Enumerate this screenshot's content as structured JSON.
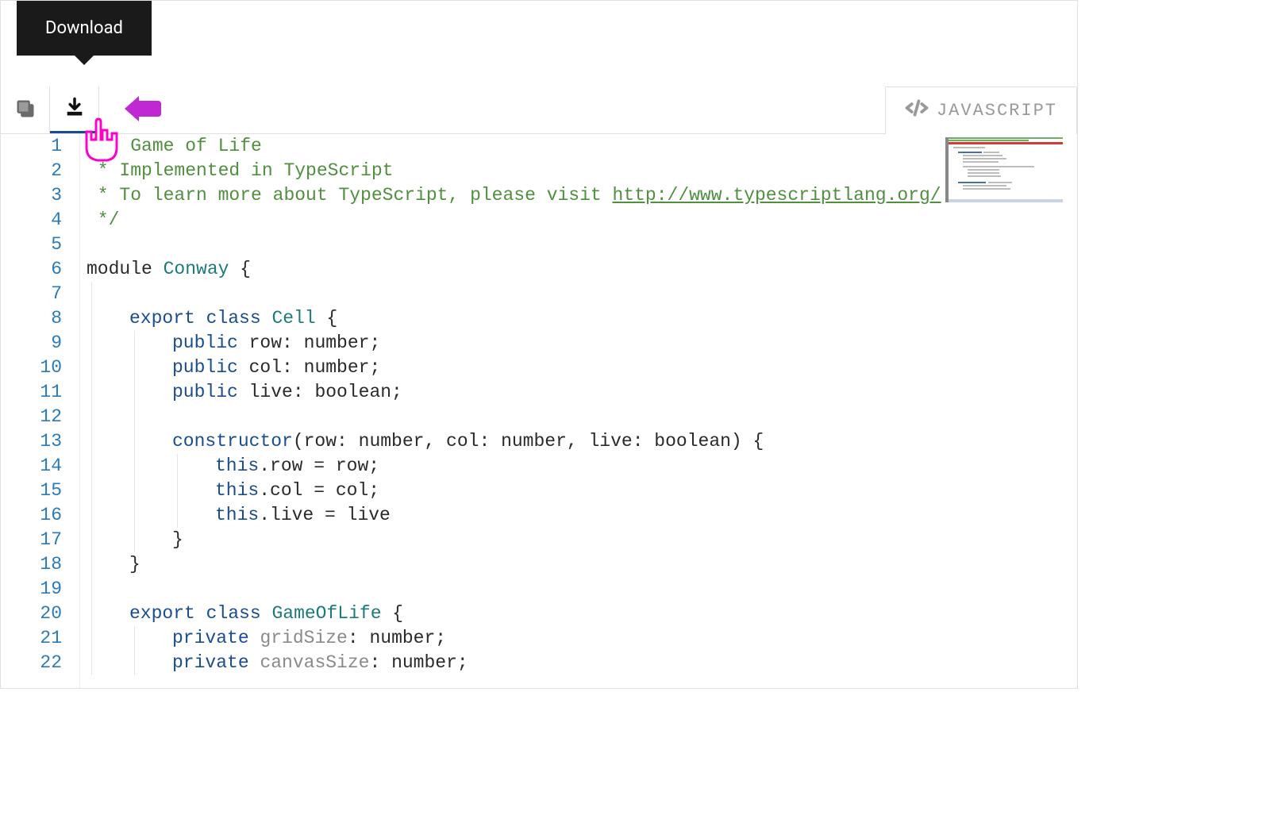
{
  "tooltip": {
    "text": "Download"
  },
  "tab": {
    "label": "JAVASCRIPT"
  },
  "colors": {
    "comment": "#4f8f3e",
    "keyword": "#1a4d8f",
    "type": "#1d7a7a",
    "plain": "#2a2a2a",
    "member": "#8a8a8a",
    "lineNumber": "#2b7bb9",
    "tooltipBg": "#1a1a1a",
    "annotationArrow": "#c028d4"
  },
  "lineNumbers": [
    "1",
    "2",
    "3",
    "4",
    "5",
    "6",
    "7",
    "8",
    "9",
    "10",
    "11",
    "12",
    "13",
    "14",
    "15",
    "16",
    "17",
    "18",
    "19",
    "20",
    "21",
    "22"
  ],
  "code": {
    "lines": [
      {
        "indent": 0,
        "tokens": [
          {
            "cls": "c-comment",
            "t": "/** Game of Life"
          }
        ]
      },
      {
        "indent": 0,
        "tokens": [
          {
            "cls": "c-comment",
            "t": " * Implemented in TypeScript"
          }
        ]
      },
      {
        "indent": 0,
        "tokens": [
          {
            "cls": "c-comment",
            "t": " * To learn more about TypeScript, please visit "
          },
          {
            "cls": "c-link",
            "t": "http://www.typescriptlang.org/"
          }
        ]
      },
      {
        "indent": 0,
        "tokens": [
          {
            "cls": "c-comment",
            "t": " */"
          }
        ]
      },
      {
        "indent": 0,
        "tokens": []
      },
      {
        "indent": 0,
        "tokens": [
          {
            "cls": "c-plain",
            "t": "module "
          },
          {
            "cls": "c-type",
            "t": "Conway"
          },
          {
            "cls": "c-plain",
            "t": " {"
          }
        ]
      },
      {
        "indent": 1,
        "tokens": []
      },
      {
        "indent": 1,
        "tokens": [
          {
            "cls": "c-keyword",
            "t": "export"
          },
          {
            "cls": "c-plain",
            "t": " "
          },
          {
            "cls": "c-keyword",
            "t": "class"
          },
          {
            "cls": "c-plain",
            "t": " "
          },
          {
            "cls": "c-type",
            "t": "Cell"
          },
          {
            "cls": "c-plain",
            "t": " {"
          }
        ]
      },
      {
        "indent": 2,
        "tokens": [
          {
            "cls": "c-keyword",
            "t": "public"
          },
          {
            "cls": "c-plain",
            "t": " row: number;"
          }
        ]
      },
      {
        "indent": 2,
        "tokens": [
          {
            "cls": "c-keyword",
            "t": "public"
          },
          {
            "cls": "c-plain",
            "t": " col: number;"
          }
        ]
      },
      {
        "indent": 2,
        "tokens": [
          {
            "cls": "c-keyword",
            "t": "public"
          },
          {
            "cls": "c-plain",
            "t": " live: boolean;"
          }
        ]
      },
      {
        "indent": 2,
        "tokens": []
      },
      {
        "indent": 2,
        "tokens": [
          {
            "cls": "c-keyword",
            "t": "constructor"
          },
          {
            "cls": "c-plain",
            "t": "(row: number, col: number, live: boolean) {"
          }
        ]
      },
      {
        "indent": 3,
        "tokens": [
          {
            "cls": "c-keyword",
            "t": "this"
          },
          {
            "cls": "c-plain",
            "t": ".row = row;"
          }
        ]
      },
      {
        "indent": 3,
        "tokens": [
          {
            "cls": "c-keyword",
            "t": "this"
          },
          {
            "cls": "c-plain",
            "t": ".col = col;"
          }
        ]
      },
      {
        "indent": 3,
        "tokens": [
          {
            "cls": "c-keyword",
            "t": "this"
          },
          {
            "cls": "c-plain",
            "t": ".live = live"
          }
        ]
      },
      {
        "indent": 2,
        "tokens": [
          {
            "cls": "c-plain",
            "t": "}"
          }
        ]
      },
      {
        "indent": 1,
        "tokens": [
          {
            "cls": "c-plain",
            "t": "}"
          }
        ]
      },
      {
        "indent": 1,
        "tokens": []
      },
      {
        "indent": 1,
        "tokens": [
          {
            "cls": "c-keyword",
            "t": "export"
          },
          {
            "cls": "c-plain",
            "t": " "
          },
          {
            "cls": "c-keyword",
            "t": "class"
          },
          {
            "cls": "c-plain",
            "t": " "
          },
          {
            "cls": "c-type",
            "t": "GameOfLife"
          },
          {
            "cls": "c-plain",
            "t": " {"
          }
        ]
      },
      {
        "indent": 2,
        "tokens": [
          {
            "cls": "c-keyword",
            "t": "private"
          },
          {
            "cls": "c-plain",
            "t": " "
          },
          {
            "cls": "c-member",
            "t": "gridSize"
          },
          {
            "cls": "c-plain",
            "t": ": number;"
          }
        ]
      },
      {
        "indent": 2,
        "tokens": [
          {
            "cls": "c-keyword",
            "t": "private"
          },
          {
            "cls": "c-plain",
            "t": " "
          },
          {
            "cls": "c-member",
            "t": "canvasSize"
          },
          {
            "cls": "c-plain",
            "t": ": number;"
          }
        ]
      }
    ]
  }
}
